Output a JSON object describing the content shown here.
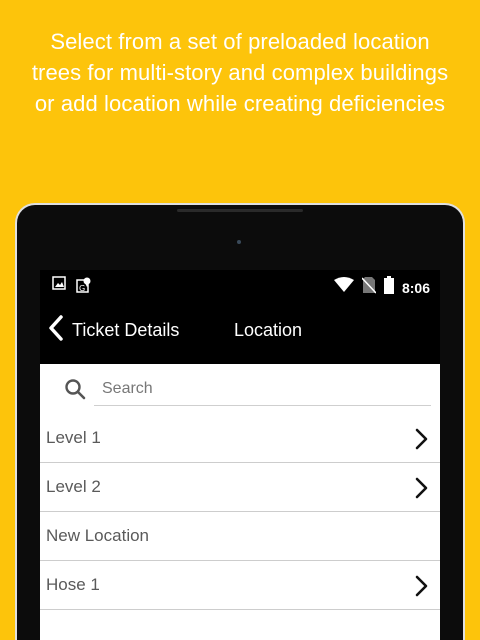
{
  "promo": {
    "line1": "Select from a set of preloaded location",
    "line2": "trees for multi-story and complex buildings",
    "line3": "or add location while creating deficiencies"
  },
  "status_bar": {
    "time": "8:06",
    "left_icons": [
      "image-icon",
      "map-location-icon"
    ],
    "right_icons": [
      "wifi-icon",
      "no-sim-icon",
      "battery-icon"
    ]
  },
  "app_bar": {
    "back_label": "Ticket Details",
    "title": "Location"
  },
  "search": {
    "placeholder": "Search",
    "value": ""
  },
  "locations": [
    {
      "label": "Level 1",
      "has_children": true
    },
    {
      "label": "Level 2",
      "has_children": true
    },
    {
      "label": "New Location",
      "has_children": false
    },
    {
      "label": "Hose 1",
      "has_children": true
    },
    {
      "label": "",
      "has_children": false
    }
  ],
  "colors": {
    "background": "#FDC40B",
    "app_bar": "#000000",
    "list_text": "#5a5a5a"
  }
}
